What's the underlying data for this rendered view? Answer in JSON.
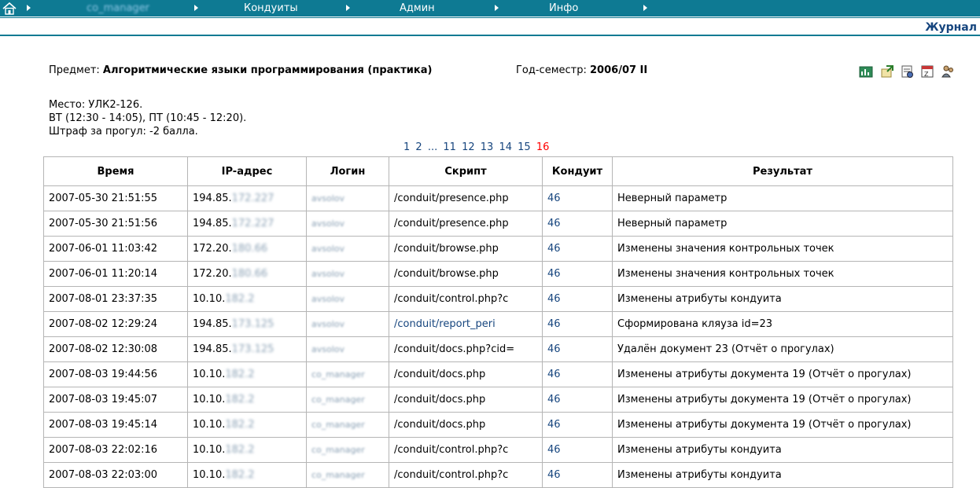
{
  "nav": {
    "user": "co_manager",
    "items": [
      "Кондуиты",
      "Админ",
      "Инфо"
    ]
  },
  "journal_label": "Журнал",
  "subject": {
    "label": "Предмет:",
    "name": "Алгоритмические языки программирования (практика)",
    "year_label": "Год-семестр:",
    "year": "2006/07 II"
  },
  "place": {
    "line1": "Место: УЛК2-126.",
    "line2": "ВТ (12:30 - 14:05), ПТ (10:45 - 12:20).",
    "line3": "Штраф за прогул: -2 балла."
  },
  "pager": {
    "pages_start": [
      "1",
      "2"
    ],
    "dots": "...",
    "pages_end": [
      "11",
      "12",
      "13",
      "14",
      "15"
    ],
    "current": "16"
  },
  "table": {
    "headers": [
      "Время",
      "IP-адрес",
      "Логин",
      "Скрипт",
      "Кондуит",
      "Результат"
    ],
    "rows": [
      {
        "time": "2007-05-30 21:51:55",
        "ip": "194.85.",
        "ip_hidden": "172.227",
        "login": "avsolov",
        "script": "/conduit/presence.php",
        "cond": "46",
        "result": "Неверный параметр"
      },
      {
        "time": "2007-05-30 21:51:56",
        "ip": "194.85.",
        "ip_hidden": "172.227",
        "login": "avsolov",
        "script": "/conduit/presence.php",
        "cond": "46",
        "result": "Неверный параметр"
      },
      {
        "time": "2007-06-01 11:03:42",
        "ip": "172.20.",
        "ip_hidden": "180.66",
        "login": "avsolov",
        "script": "/conduit/browse.php",
        "cond": "46",
        "result": "Изменены значения контрольных точек"
      },
      {
        "time": "2007-06-01 11:20:14",
        "ip": "172.20.",
        "ip_hidden": "180.66",
        "login": "avsolov",
        "script": "/conduit/browse.php",
        "cond": "46",
        "result": "Изменены значения контрольных точек"
      },
      {
        "time": "2007-08-01 23:37:35",
        "ip": "10.10.",
        "ip_hidden": "182.2",
        "login": "avsolov",
        "script": "/conduit/control.php?c",
        "cond": "46",
        "result": "Изменены атрибуты кондуита"
      },
      {
        "time": "2007-08-02 12:29:24",
        "ip": "194.85.",
        "ip_hidden": "173.125",
        "login": "avsolov",
        "script": "/conduit/report_peri",
        "cond": "46",
        "result": "Сформирована кляуза id=23"
      },
      {
        "time": "2007-08-02 12:30:08",
        "ip": "194.85.",
        "ip_hidden": "173.125",
        "login": "avsolov",
        "script": "/conduit/docs.php?cid=",
        "cond": "46",
        "result": "Удалён документ 23 (Отчёт о прогулах)"
      },
      {
        "time": "2007-08-03 19:44:56",
        "ip": "10.10.",
        "ip_hidden": "182.2",
        "login": "co_manager",
        "script": "/conduit/docs.php",
        "cond": "46",
        "result": "Изменены атрибуты документа 19 (Отчёт о прогулах)"
      },
      {
        "time": "2007-08-03 19:45:07",
        "ip": "10.10.",
        "ip_hidden": "182.2",
        "login": "co_manager",
        "script": "/conduit/docs.php",
        "cond": "46",
        "result": "Изменены атрибуты документа 19 (Отчёт о прогулах)"
      },
      {
        "time": "2007-08-03 19:45:14",
        "ip": "10.10.",
        "ip_hidden": "182.2",
        "login": "co_manager",
        "script": "/conduit/docs.php",
        "cond": "46",
        "result": "Изменены атрибуты документа 19 (Отчёт о прогулах)"
      },
      {
        "time": "2007-08-03 22:02:16",
        "ip": "10.10.",
        "ip_hidden": "182.2",
        "login": "co_manager",
        "script": "/conduit/control.php?c",
        "cond": "46",
        "result": "Изменены атрибуты кондуита"
      },
      {
        "time": "2007-08-03 22:03:00",
        "ip": "10.10.",
        "ip_hidden": "182.2",
        "login": "co_manager",
        "script": "/conduit/control.php?c",
        "cond": "46",
        "result": "Изменены атрибуты кондуита"
      }
    ]
  },
  "colors": {
    "nav_bg": "#0e7a93",
    "link": "#16457e",
    "current_page": "#ff0000"
  },
  "icons": [
    "home-icon",
    "chart-icon",
    "export-icon",
    "properties-icon",
    "calendar-icon",
    "users-icon"
  ]
}
